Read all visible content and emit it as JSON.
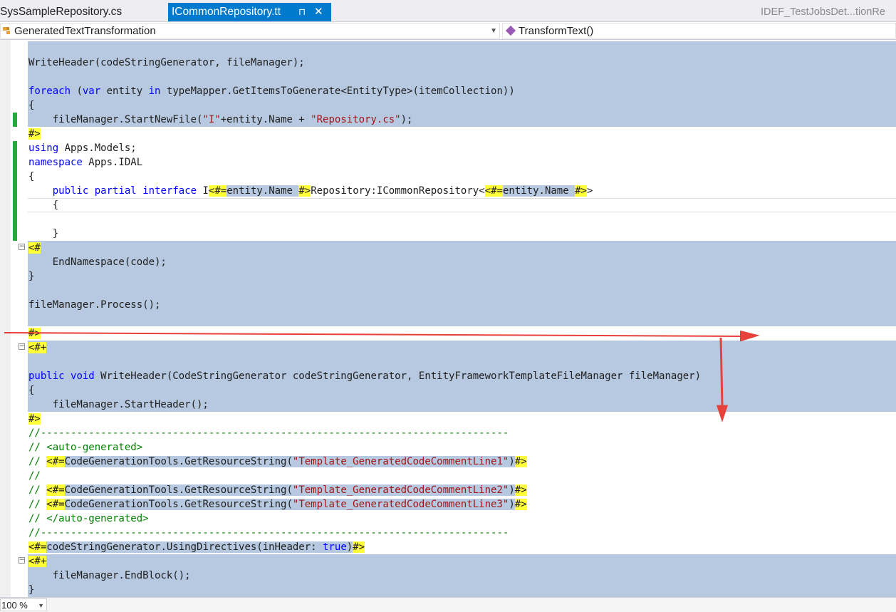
{
  "tabs": {
    "left_label": "SysSampleRepository.cs",
    "active_label": "ICommonRepository.tt",
    "pin_glyph": "⊓",
    "close_glyph": "✕",
    "right_label": "IDEF_TestJobsDet...tionRe"
  },
  "navbar": {
    "left_value": "GeneratedTextTransformation",
    "right_value": "TransformText()"
  },
  "status": {
    "zoom": "100 %"
  },
  "colors": {
    "accent": "#007acc",
    "block_bg": "#b7c9e0",
    "tag_bg": "#ffff3a",
    "changed": "#1fad3b",
    "keyword": "#0000ff",
    "string": "#a31515",
    "comment": "#008000",
    "annotation_arrow": "#e8403a"
  },
  "icons": {
    "nav_left": "class-icon",
    "nav_right": "method-icon",
    "fold_collapse": "fold-minus-icon"
  },
  "code_lines": [
    {
      "row": 0,
      "block": true,
      "changed": false,
      "fold": "",
      "parts": []
    },
    {
      "row": 1,
      "block": true,
      "changed": false,
      "fold": "",
      "parts": [
        [
          "",
          "WriteHeader(codeStringGenerator, fileManager);"
        ]
      ]
    },
    {
      "row": 2,
      "block": true,
      "changed": false,
      "fold": "",
      "parts": []
    },
    {
      "row": 3,
      "block": true,
      "changed": false,
      "fold": "",
      "parts": [
        [
          "k",
          "foreach"
        ],
        [
          "",
          " ("
        ],
        [
          "k",
          "var"
        ],
        [
          "",
          " entity "
        ],
        [
          "k",
          "in"
        ],
        [
          "",
          " typeMapper.GetItemsToGenerate<EntityType>(itemCollection))"
        ]
      ]
    },
    {
      "row": 4,
      "block": true,
      "changed": false,
      "fold": "",
      "parts": [
        [
          "",
          "{"
        ]
      ]
    },
    {
      "row": 5,
      "block": true,
      "changed": true,
      "fold": "",
      "parts": [
        [
          "",
          "    fileManager.StartNewFile("
        ],
        [
          "s",
          "\"I\""
        ],
        [
          "",
          "+entity.Name + "
        ],
        [
          "s",
          "\"Repository.cs\""
        ],
        [
          "",
          ");"
        ]
      ]
    },
    {
      "row": 6,
      "block": false,
      "changed": false,
      "fold": "",
      "parts": [
        [
          "t",
          "#>"
        ]
      ]
    },
    {
      "row": 7,
      "block": false,
      "changed": true,
      "fold": "",
      "parts": [
        [
          "k",
          "using"
        ],
        [
          "",
          " Apps.Models;"
        ]
      ]
    },
    {
      "row": 8,
      "block": false,
      "changed": true,
      "fold": "",
      "parts": [
        [
          "k",
          "namespace"
        ],
        [
          "",
          " Apps.IDAL"
        ]
      ]
    },
    {
      "row": 9,
      "block": false,
      "changed": true,
      "fold": "",
      "parts": [
        [
          "",
          "{"
        ]
      ]
    },
    {
      "row": 10,
      "block": false,
      "changed": true,
      "fold": "",
      "parts": [
        [
          "",
          "    "
        ],
        [
          "k",
          "public"
        ],
        [
          "",
          " "
        ],
        [
          "k",
          "partial"
        ],
        [
          "",
          " "
        ],
        [
          "k",
          "interface"
        ],
        [
          "",
          " I"
        ],
        [
          "t",
          "<#="
        ],
        [
          "e",
          "entity.Name "
        ],
        [
          "t",
          "#>"
        ],
        [
          "",
          "Repository:ICommonRepository<"
        ],
        [
          "t",
          "<#="
        ],
        [
          "e",
          "entity.Name "
        ],
        [
          "t",
          "#>"
        ],
        [
          "",
          ">"
        ]
      ]
    },
    {
      "row": 11,
      "block": false,
      "changed": true,
      "cursor": true,
      "fold": "",
      "parts": [
        [
          "",
          "    {"
        ]
      ]
    },
    {
      "row": 12,
      "block": false,
      "changed": true,
      "fold": "",
      "parts": []
    },
    {
      "row": 13,
      "block": false,
      "changed": true,
      "fold": "",
      "parts": [
        [
          "",
          "    }"
        ]
      ]
    },
    {
      "row": 14,
      "block": true,
      "changed": false,
      "fold": "minus",
      "parts": [
        [
          "t",
          "<#"
        ]
      ]
    },
    {
      "row": 15,
      "block": true,
      "changed": false,
      "fold": "",
      "parts": [
        [
          "",
          "    EndNamespace(code);"
        ]
      ]
    },
    {
      "row": 16,
      "block": true,
      "changed": false,
      "fold": "",
      "parts": [
        [
          "",
          "}"
        ]
      ]
    },
    {
      "row": 17,
      "block": true,
      "changed": false,
      "fold": "",
      "parts": []
    },
    {
      "row": 18,
      "block": true,
      "changed": false,
      "fold": "",
      "parts": [
        [
          "",
          "fileManager.Process();"
        ]
      ]
    },
    {
      "row": 19,
      "block": true,
      "changed": false,
      "fold": "",
      "parts": []
    },
    {
      "row": 20,
      "block": false,
      "changed": false,
      "fold": "",
      "parts": [
        [
          "t",
          "#>"
        ]
      ]
    },
    {
      "row": 21,
      "block": true,
      "changed": false,
      "fold": "minus",
      "parts": [
        [
          "t",
          "<#+"
        ]
      ]
    },
    {
      "row": 22,
      "block": true,
      "changed": false,
      "fold": "",
      "parts": []
    },
    {
      "row": 23,
      "block": true,
      "changed": false,
      "fold": "",
      "parts": [
        [
          "k",
          "public"
        ],
        [
          "",
          " "
        ],
        [
          "k",
          "void"
        ],
        [
          "",
          " WriteHeader(CodeStringGenerator codeStringGenerator, EntityFrameworkTemplateFileManager fileManager)"
        ]
      ]
    },
    {
      "row": 24,
      "block": true,
      "changed": false,
      "fold": "",
      "parts": [
        [
          "",
          "{"
        ]
      ]
    },
    {
      "row": 25,
      "block": true,
      "changed": false,
      "fold": "",
      "parts": [
        [
          "",
          "    fileManager.StartHeader();"
        ]
      ]
    },
    {
      "row": 26,
      "block": false,
      "changed": false,
      "fold": "",
      "parts": [
        [
          "t",
          "#>"
        ]
      ]
    },
    {
      "row": 27,
      "block": false,
      "changed": false,
      "fold": "",
      "parts": [
        [
          "c",
          "//------------------------------------------------------------------------------"
        ]
      ]
    },
    {
      "row": 28,
      "block": false,
      "changed": false,
      "fold": "",
      "parts": [
        [
          "c",
          "// <auto-generated>"
        ]
      ]
    },
    {
      "row": 29,
      "block": false,
      "changed": false,
      "fold": "",
      "parts": [
        [
          "c",
          "// "
        ],
        [
          "t",
          "<#="
        ],
        [
          "e",
          "CodeGenerationTools.GetResourceString("
        ],
        [
          "s e",
          "\"Template_GeneratedCodeCommentLine1\""
        ],
        [
          "e",
          ")"
        ],
        [
          "t",
          "#>"
        ]
      ]
    },
    {
      "row": 30,
      "block": false,
      "changed": false,
      "fold": "",
      "parts": [
        [
          "c",
          "//"
        ]
      ]
    },
    {
      "row": 31,
      "block": false,
      "changed": false,
      "fold": "",
      "parts": [
        [
          "c",
          "// "
        ],
        [
          "t",
          "<#="
        ],
        [
          "e",
          "CodeGenerationTools.GetResourceString("
        ],
        [
          "s e",
          "\"Template_GeneratedCodeCommentLine2\""
        ],
        [
          "e",
          ")"
        ],
        [
          "t",
          "#>"
        ]
      ]
    },
    {
      "row": 32,
      "block": false,
      "changed": false,
      "fold": "",
      "parts": [
        [
          "c",
          "// "
        ],
        [
          "t",
          "<#="
        ],
        [
          "e",
          "CodeGenerationTools.GetResourceString("
        ],
        [
          "s e",
          "\"Template_GeneratedCodeCommentLine3\""
        ],
        [
          "e",
          ")"
        ],
        [
          "t",
          "#>"
        ]
      ]
    },
    {
      "row": 33,
      "block": false,
      "changed": false,
      "fold": "",
      "parts": [
        [
          "c",
          "// </auto-generated>"
        ]
      ]
    },
    {
      "row": 34,
      "block": false,
      "changed": false,
      "fold": "",
      "parts": [
        [
          "c",
          "//------------------------------------------------------------------------------"
        ]
      ]
    },
    {
      "row": 35,
      "block": false,
      "changed": false,
      "fold": "",
      "parts": [
        [
          "t",
          "<#="
        ],
        [
          "e",
          "codeStringGenerator.UsingDirectives(inHeader: "
        ],
        [
          "k e",
          "true"
        ],
        [
          "e",
          ")"
        ],
        [
          "t",
          "#>"
        ]
      ]
    },
    {
      "row": 36,
      "block": true,
      "changed": false,
      "fold": "minus",
      "parts": [
        [
          "t",
          "<#+"
        ]
      ]
    },
    {
      "row": 37,
      "block": true,
      "changed": false,
      "fold": "",
      "parts": [
        [
          "",
          "    fileManager.EndBlock();"
        ]
      ]
    },
    {
      "row": 38,
      "block": true,
      "changed": false,
      "fold": "",
      "parts": [
        [
          "",
          "}"
        ]
      ]
    }
  ]
}
